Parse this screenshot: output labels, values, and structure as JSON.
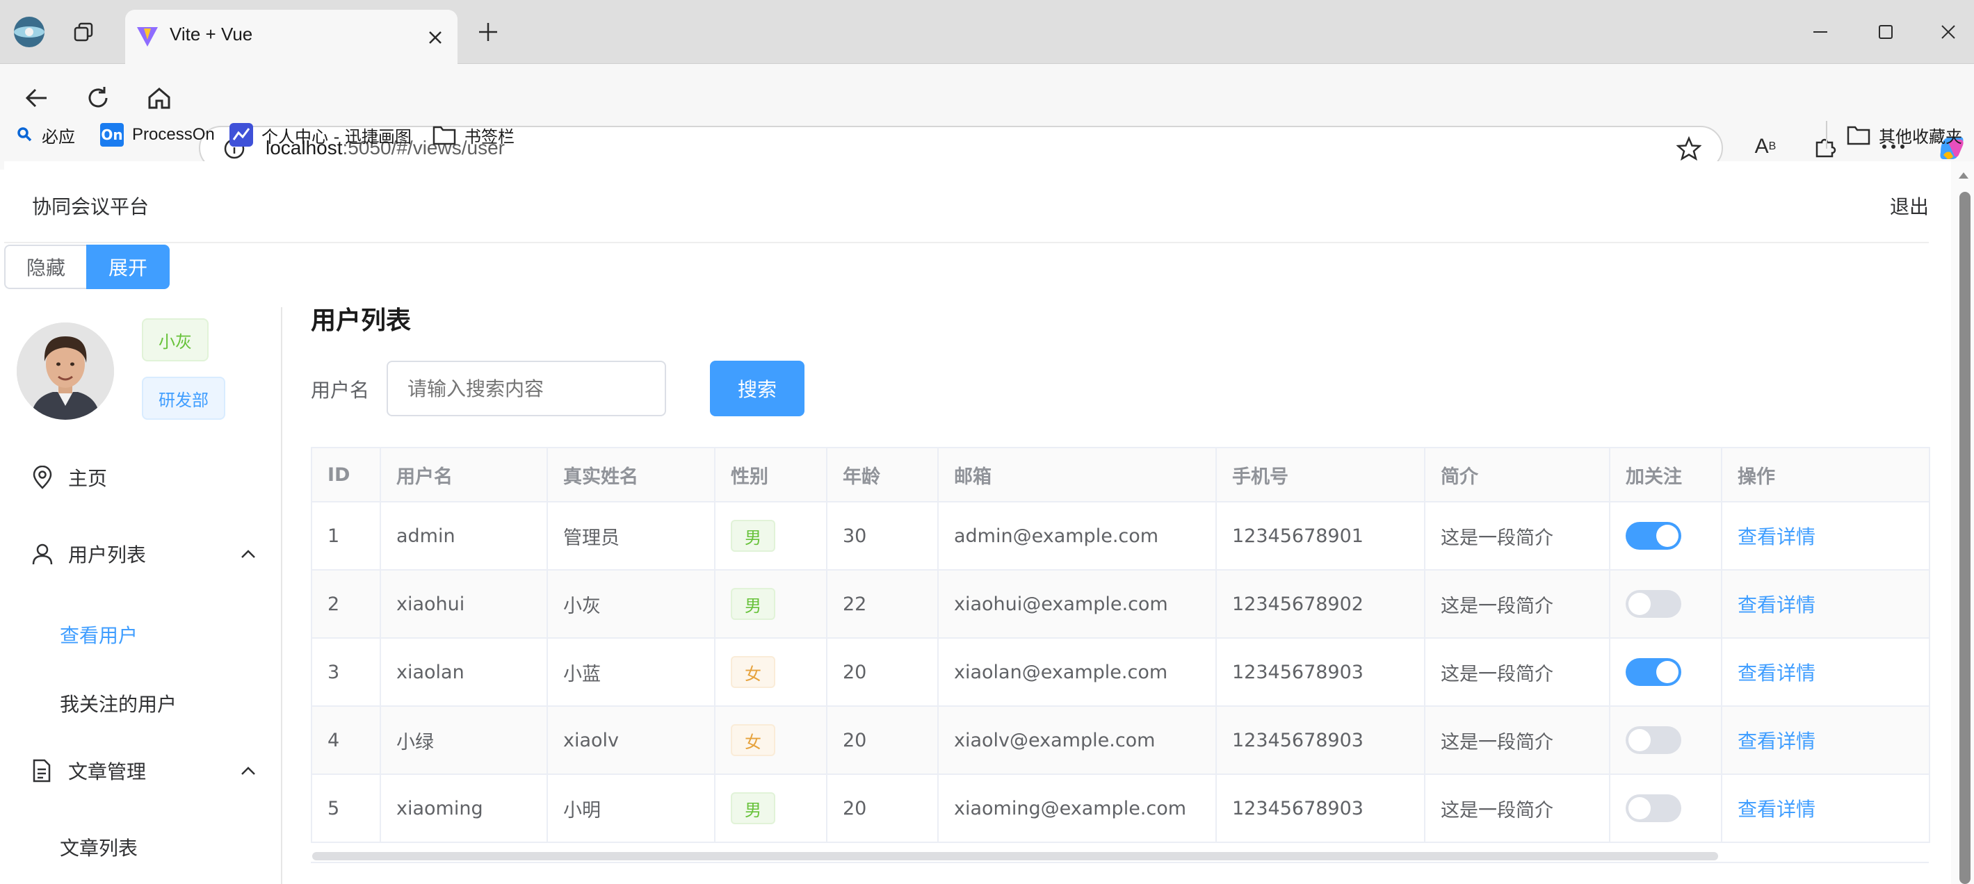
{
  "browser": {
    "tab_title": "Vite + Vue",
    "url_host": "localhost",
    "url_rest": ":5050/#/views/user",
    "bookmarks": [
      "必应",
      "ProcessOn",
      "个人中心 - 迅捷画图",
      "书签栏"
    ],
    "other_bookmarks": "其他收藏夹",
    "processon_badge": "On"
  },
  "header": {
    "title": "协同会议平台",
    "logout": "退出"
  },
  "toggle": {
    "hide": "隐藏",
    "expand": "展开"
  },
  "profile": {
    "name_tag": "小灰",
    "dept_tag": "研发部"
  },
  "menu": {
    "home": "主页",
    "user_list": "用户列表",
    "view_users": "查看用户",
    "followed_users": "我关注的用户",
    "article_mgmt": "文章管理",
    "article_list": "文章列表"
  },
  "main": {
    "page_title": "用户列表",
    "search_label": "用户名",
    "search_placeholder": "请输入搜索内容",
    "search_button": "搜索"
  },
  "table": {
    "columns": [
      "ID",
      "用户名",
      "真实姓名",
      "性别",
      "年龄",
      "邮箱",
      "手机号",
      "简介",
      "加关注",
      "操作"
    ],
    "action_label": "查看详情",
    "rows": [
      {
        "id": "1",
        "username": "admin",
        "realname": "管理员",
        "sex": "男",
        "sex_type": "male",
        "age": "30",
        "email": "admin@example.com",
        "phone": "12345678901",
        "intro": "这是一段简介",
        "follow": true
      },
      {
        "id": "2",
        "username": "xiaohui",
        "realname": "小灰",
        "sex": "男",
        "sex_type": "male",
        "age": "22",
        "email": "xiaohui@example.com",
        "phone": "12345678902",
        "intro": "这是一段简介",
        "follow": false
      },
      {
        "id": "3",
        "username": "xiaolan",
        "realname": "小蓝",
        "sex": "女",
        "sex_type": "female",
        "age": "20",
        "email": "xiaolan@example.com",
        "phone": "12345678903",
        "intro": "这是一段简介",
        "follow": true
      },
      {
        "id": "4",
        "username": "小绿",
        "realname": "xiaolv",
        "sex": "女",
        "sex_type": "female",
        "age": "20",
        "email": "xiaolv@example.com",
        "phone": "12345678903",
        "intro": "这是一段简介",
        "follow": false
      },
      {
        "id": "5",
        "username": "xiaoming",
        "realname": "小明",
        "sex": "男",
        "sex_type": "male",
        "age": "20",
        "email": "xiaoming@example.com",
        "phone": "12345678903",
        "intro": "这是一段简介",
        "follow": false
      }
    ]
  },
  "colors": {
    "primary": "#409eff",
    "success": "#67c23a",
    "warning": "#e6a23c"
  }
}
